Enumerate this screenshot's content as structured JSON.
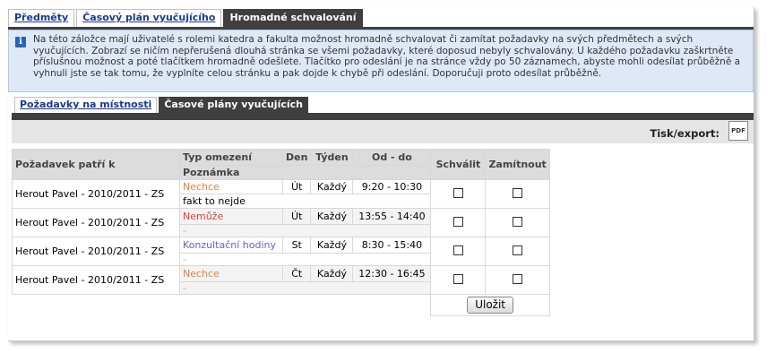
{
  "top_tabs": [
    {
      "label": "Předměty"
    },
    {
      "label": "Časový plán vyučujícího"
    },
    {
      "label": "Hromadné schvalování"
    }
  ],
  "info": {
    "icon": "info-icon",
    "text": "Na této záložce mají uživatelé s rolemi katedra a fakulta možnost hromadně schvalovat či zamítat požadavky na svých předmětech a svých vyučujících. Zobrazí se ničím nepřerušená dlouhá stránka se všemi požadavky, které doposud nebyly schvalovány. U každého požadavku zaškrtněte příslušnou možnost a poté tlačítkem hromadně odešlete. Tlačítko pro odeslání je na stránce vždy po 50 záznamech, abyste mohli odesílat průběžně a vyhnuli jste se tak tomu, že vyplníte celou stránku a pak dojde k chybě při odeslání. Doporučuji proto odesílat průběžně."
  },
  "sub_tabs": [
    {
      "label": "Požadavky na místnosti"
    },
    {
      "label": "Časové plány vyučujících"
    }
  ],
  "export": {
    "label": "Tisk/export:",
    "icon": "pdf-icon",
    "icon_text": "PDF"
  },
  "table": {
    "headers": {
      "owner": "Požadavek patří k",
      "type": "Typ omezení",
      "note": "Poznámka",
      "day": "Den",
      "week": "Týden",
      "time": "Od - do",
      "approve": "Schválit",
      "reject": "Zamítnout"
    },
    "rows": [
      {
        "owner": "Herout Pavel - 2010/2011 - ZS",
        "type": "Nechce",
        "note": "fakt to nejde",
        "day": "Út",
        "week": "Každý",
        "time": "9:20 - 10:30"
      },
      {
        "owner": "Herout Pavel - 2010/2011 - ZS",
        "type": "Nemůže",
        "note": "-",
        "day": "Út",
        "week": "Každý",
        "time": "13:55 - 14:40"
      },
      {
        "owner": "Herout Pavel - 2010/2011 - ZS",
        "type": "Konzultační hodiny",
        "note": "-",
        "day": "St",
        "week": "Každý",
        "time": "8:30 - 15:40"
      },
      {
        "owner": "Herout Pavel - 2010/2011 - ZS",
        "type": "Nechce",
        "note": "-",
        "day": "Čt",
        "week": "Každý",
        "time": "12:30 - 16:45"
      }
    ],
    "submit_label": "Uložit"
  },
  "colors": {
    "dark": "#3f3f3f",
    "link": "#1a3a8f",
    "info_bg": "#dfe8f6",
    "nechce": "#e8803a",
    "nemuze": "#e0443a",
    "konzultace": "#6464c8"
  }
}
